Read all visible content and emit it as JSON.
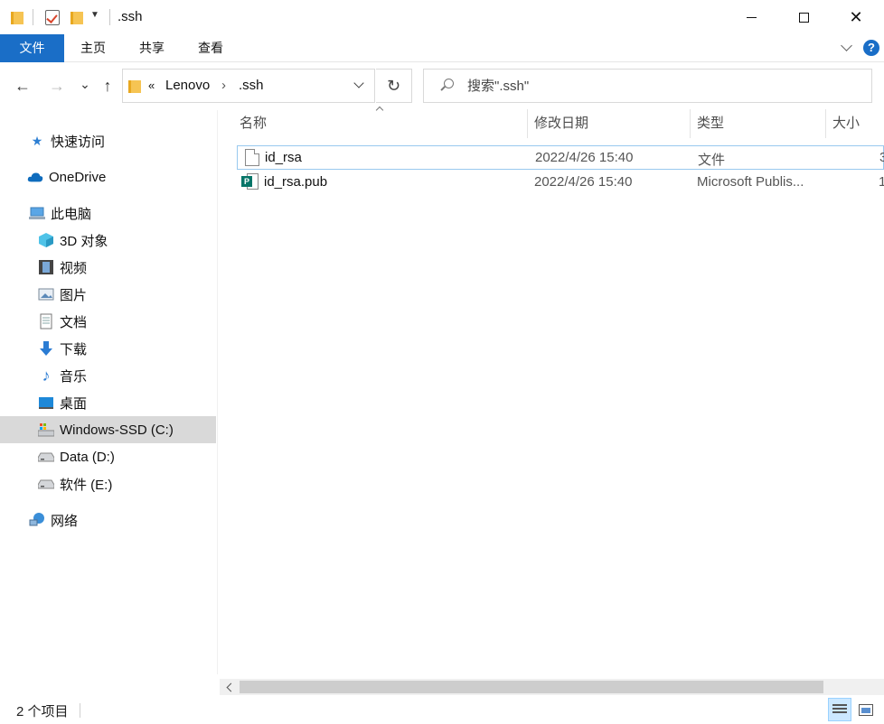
{
  "window": {
    "title": ".ssh",
    "minimize_label": "",
    "maximize_label": "",
    "close_label": "✕"
  },
  "ribbon": {
    "tabs": [
      "文件",
      "主页",
      "共享",
      "查看"
    ],
    "help_label": "?"
  },
  "navigation": {
    "back_label": "←",
    "forward_label": "→",
    "recent_label": "⌄",
    "up_label": "↑",
    "refresh_label": "↻"
  },
  "address": {
    "overflow_label": "«",
    "separator": "›",
    "crumbs": [
      "Lenovo",
      ".ssh"
    ]
  },
  "search": {
    "placeholder": "搜索\".ssh\""
  },
  "sidebar": {
    "items": [
      {
        "label": "快速访问"
      },
      {
        "label": "OneDrive"
      },
      {
        "label": "此电脑"
      },
      {
        "label": "3D 对象"
      },
      {
        "label": "视频"
      },
      {
        "label": "图片"
      },
      {
        "label": "文档"
      },
      {
        "label": "下载"
      },
      {
        "label": "音乐"
      },
      {
        "label": "桌面"
      },
      {
        "label": "Windows-SSD (C:)"
      },
      {
        "label": "Data (D:)"
      },
      {
        "label": "软件 (E:)"
      },
      {
        "label": "网络"
      }
    ],
    "selected": "Windows-SSD (C:)"
  },
  "columns": {
    "name": "名称",
    "date": "修改日期",
    "type": "类型",
    "size": "大小"
  },
  "files": [
    {
      "name": "id_rsa",
      "date": "2022/4/26 15:40",
      "type": "文件",
      "size": "3"
    },
    {
      "name": "id_rsa.pub",
      "date": "2022/4/26 15:40",
      "type": "Microsoft Publis...",
      "size": "1"
    }
  ],
  "status": {
    "item_count": "2 个项目"
  },
  "colors": {
    "accent": "#1a6ec7",
    "selection": "#d9d9d9",
    "focus_border": "#99c9ef",
    "publisher_green": "#077568"
  }
}
